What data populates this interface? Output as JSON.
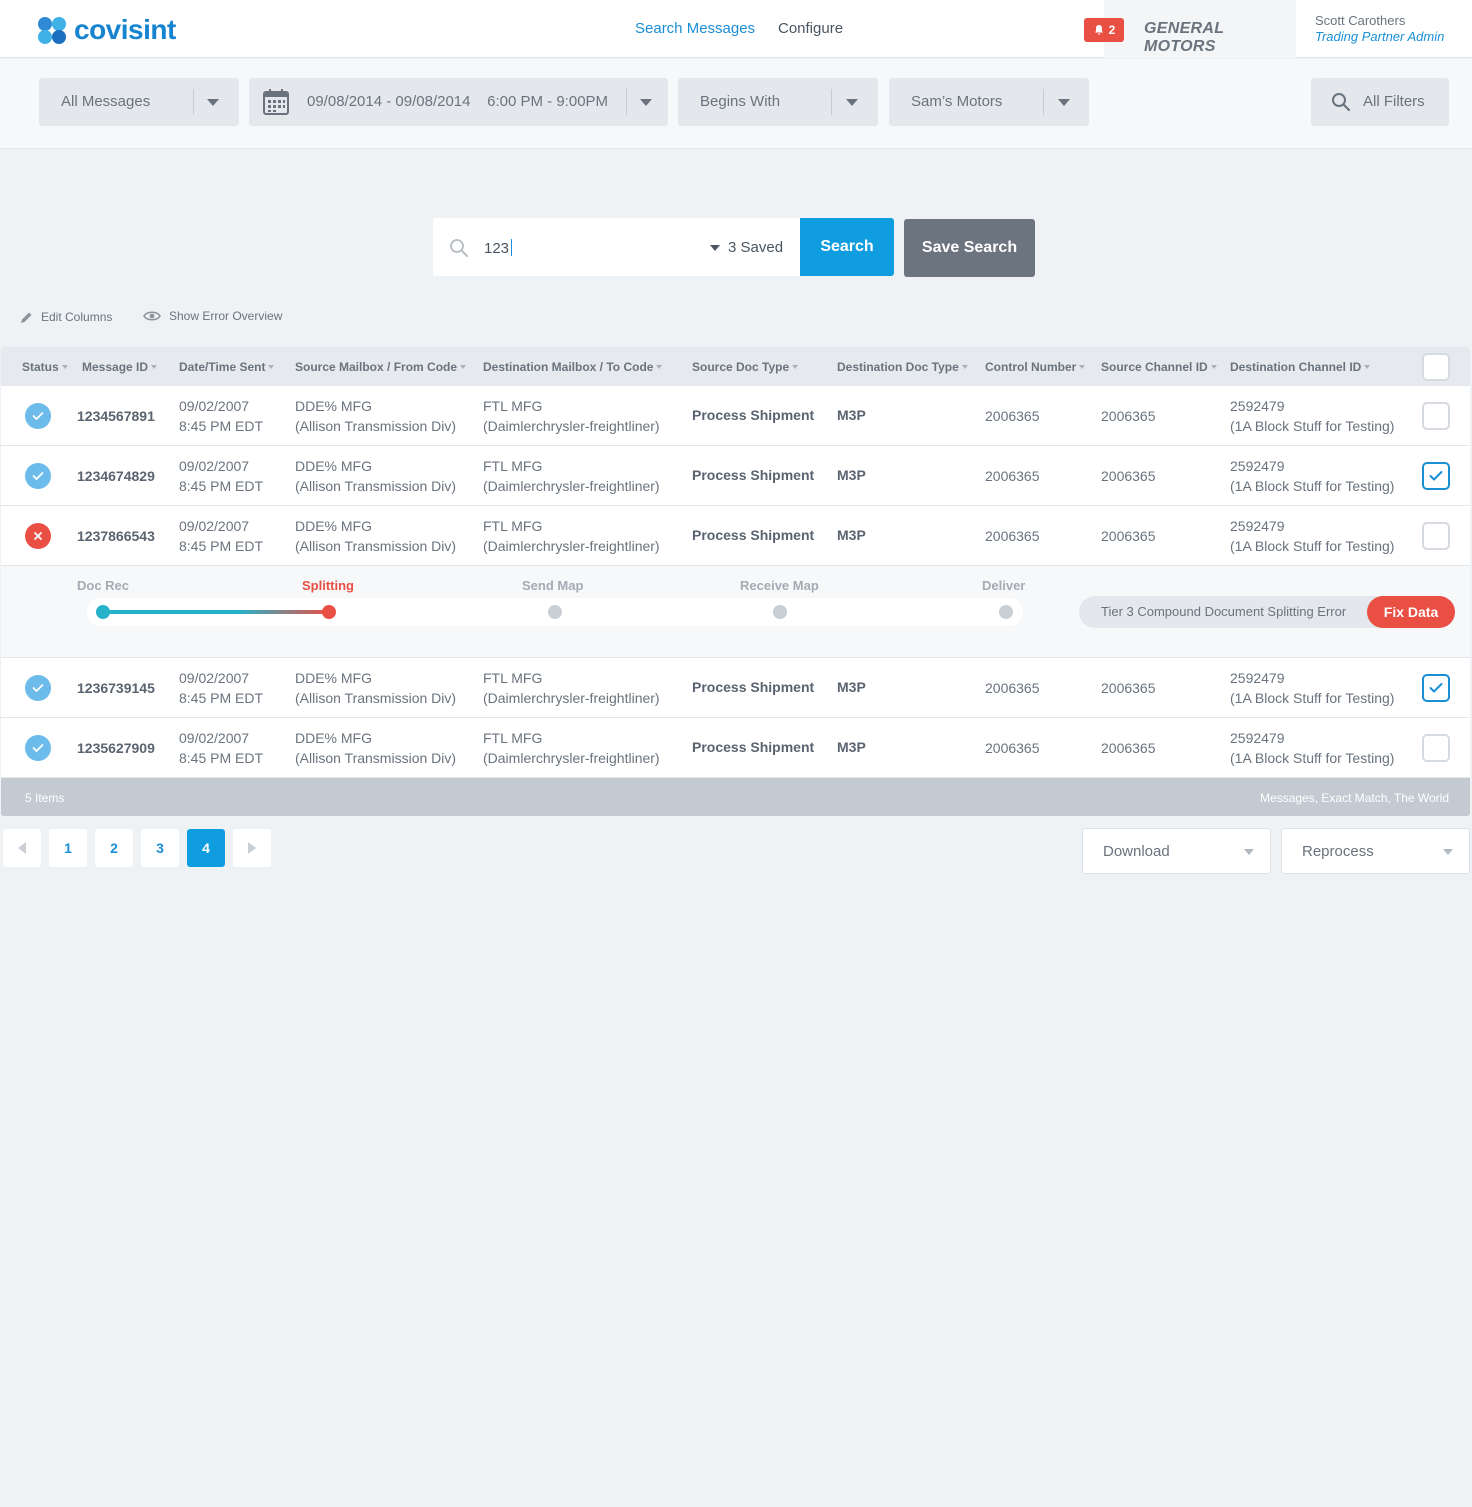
{
  "header": {
    "logo_text": "covisint",
    "nav": {
      "search_messages": "Search Messages",
      "configure": "Configure"
    },
    "notification_count": "2",
    "brand": "GENERAL MOTORS",
    "user_name": "Scott Carothers",
    "user_role": "Trading Partner Admin"
  },
  "filters": {
    "message_type": "All Messages",
    "date_range": "09/08/2014 - 09/08/2014    6:00 PM - 9:00PM",
    "match_mode": "Begins With",
    "partner": "Sam’s Motors",
    "all_filters": "All Filters"
  },
  "search": {
    "value": "123",
    "saved_label": "3 Saved",
    "search_button": "Search",
    "save_button": "Save Search"
  },
  "tools": {
    "edit_columns": "Edit Columns",
    "show_error_overview": "Show Error Overview"
  },
  "columns": [
    "Status",
    "Message ID",
    "Date/Time Sent",
    "Source Mailbox / From Code",
    "Destination Mailbox / To Code",
    "Source Doc Type",
    "Destination Doc Type",
    "Control Number",
    "Source Channel ID",
    "Destination Channel ID"
  ],
  "rows": [
    {
      "status": "ok",
      "id": "1234567891",
      "date": "09/02/2007",
      "time": "8:45 PM EDT",
      "src1": "DDE% MFG",
      "src2": "(Allison Transmission Div)",
      "dst1": "FTL MFG",
      "dst2": "(Daimlerchrysler-freightliner)",
      "src_doc": "Process Shipment",
      "dst_doc": "M3P",
      "control": "2006365",
      "src_ch": "2006365",
      "dst_ch1": "2592479",
      "dst_ch2": "(1A Block Stuff for Testing)",
      "checked": false
    },
    {
      "status": "ok",
      "id": "1234674829",
      "date": "09/02/2007",
      "time": "8:45 PM EDT",
      "src1": "DDE% MFG",
      "src2": "(Allison Transmission Div)",
      "dst1": "FTL MFG",
      "dst2": "(Daimlerchrysler-freightliner)",
      "src_doc": "Process Shipment",
      "dst_doc": "M3P",
      "control": "2006365",
      "src_ch": "2006365",
      "dst_ch1": "2592479",
      "dst_ch2": "(1A Block Stuff for Testing)",
      "checked": true
    },
    {
      "status": "error",
      "id": "1237866543",
      "date": "09/02/2007",
      "time": "8:45 PM EDT",
      "src1": "DDE% MFG",
      "src2": "(Allison Transmission Div)",
      "dst1": "FTL MFG",
      "dst2": "(Daimlerchrysler-freightliner)",
      "src_doc": "Process Shipment",
      "dst_doc": "M3P",
      "control": "2006365",
      "src_ch": "2006365",
      "dst_ch1": "2592479",
      "dst_ch2": "(1A Block Stuff for Testing)",
      "checked": false
    },
    {
      "status": "ok",
      "id": "1236739145",
      "date": "09/02/2007",
      "time": "8:45 PM EDT",
      "src1": "DDE% MFG",
      "src2": "(Allison Transmission Div)",
      "dst1": "FTL MFG",
      "dst2": "(Daimlerchrysler-freightliner)",
      "src_doc": "Process Shipment",
      "dst_doc": "M3P",
      "control": "2006365",
      "src_ch": "2006365",
      "dst_ch1": "2592479",
      "dst_ch2": "(1A Block Stuff for Testing)",
      "checked": true
    },
    {
      "status": "ok",
      "id": "1235627909",
      "date": "09/02/2007",
      "time": "8:45 PM EDT",
      "src1": "DDE% MFG",
      "src2": "(Allison Transmission Div)",
      "dst1": "FTL MFG",
      "dst2": "(Daimlerchrysler-freightliner)",
      "src_doc": "Process Shipment",
      "dst_doc": "M3P",
      "control": "2006365",
      "src_ch": "2006365",
      "dst_ch1": "2592479",
      "dst_ch2": "(1A Block Stuff for Testing)",
      "checked": false
    }
  ],
  "pipeline": {
    "stages": [
      "Doc Rec",
      "Splitting",
      "Send Map",
      "Receive Map",
      "Deliver"
    ],
    "current_stage": "Splitting",
    "error_message": "Tier 3 Compound Document Splitting Error",
    "fix_button": "Fix Data"
  },
  "footer": {
    "item_count": "5 Items",
    "search_summary": "Messages, Exact Match, The World"
  },
  "pagination": {
    "pages": [
      "1",
      "2",
      "3",
      "4"
    ],
    "current": "4"
  },
  "actions": {
    "download": "Download",
    "reprocess": "Reprocess"
  },
  "colors": {
    "accent": "#0f9de0",
    "error": "#ea4f43",
    "ok": "#6dbbea",
    "progress": "#26b3c9"
  }
}
